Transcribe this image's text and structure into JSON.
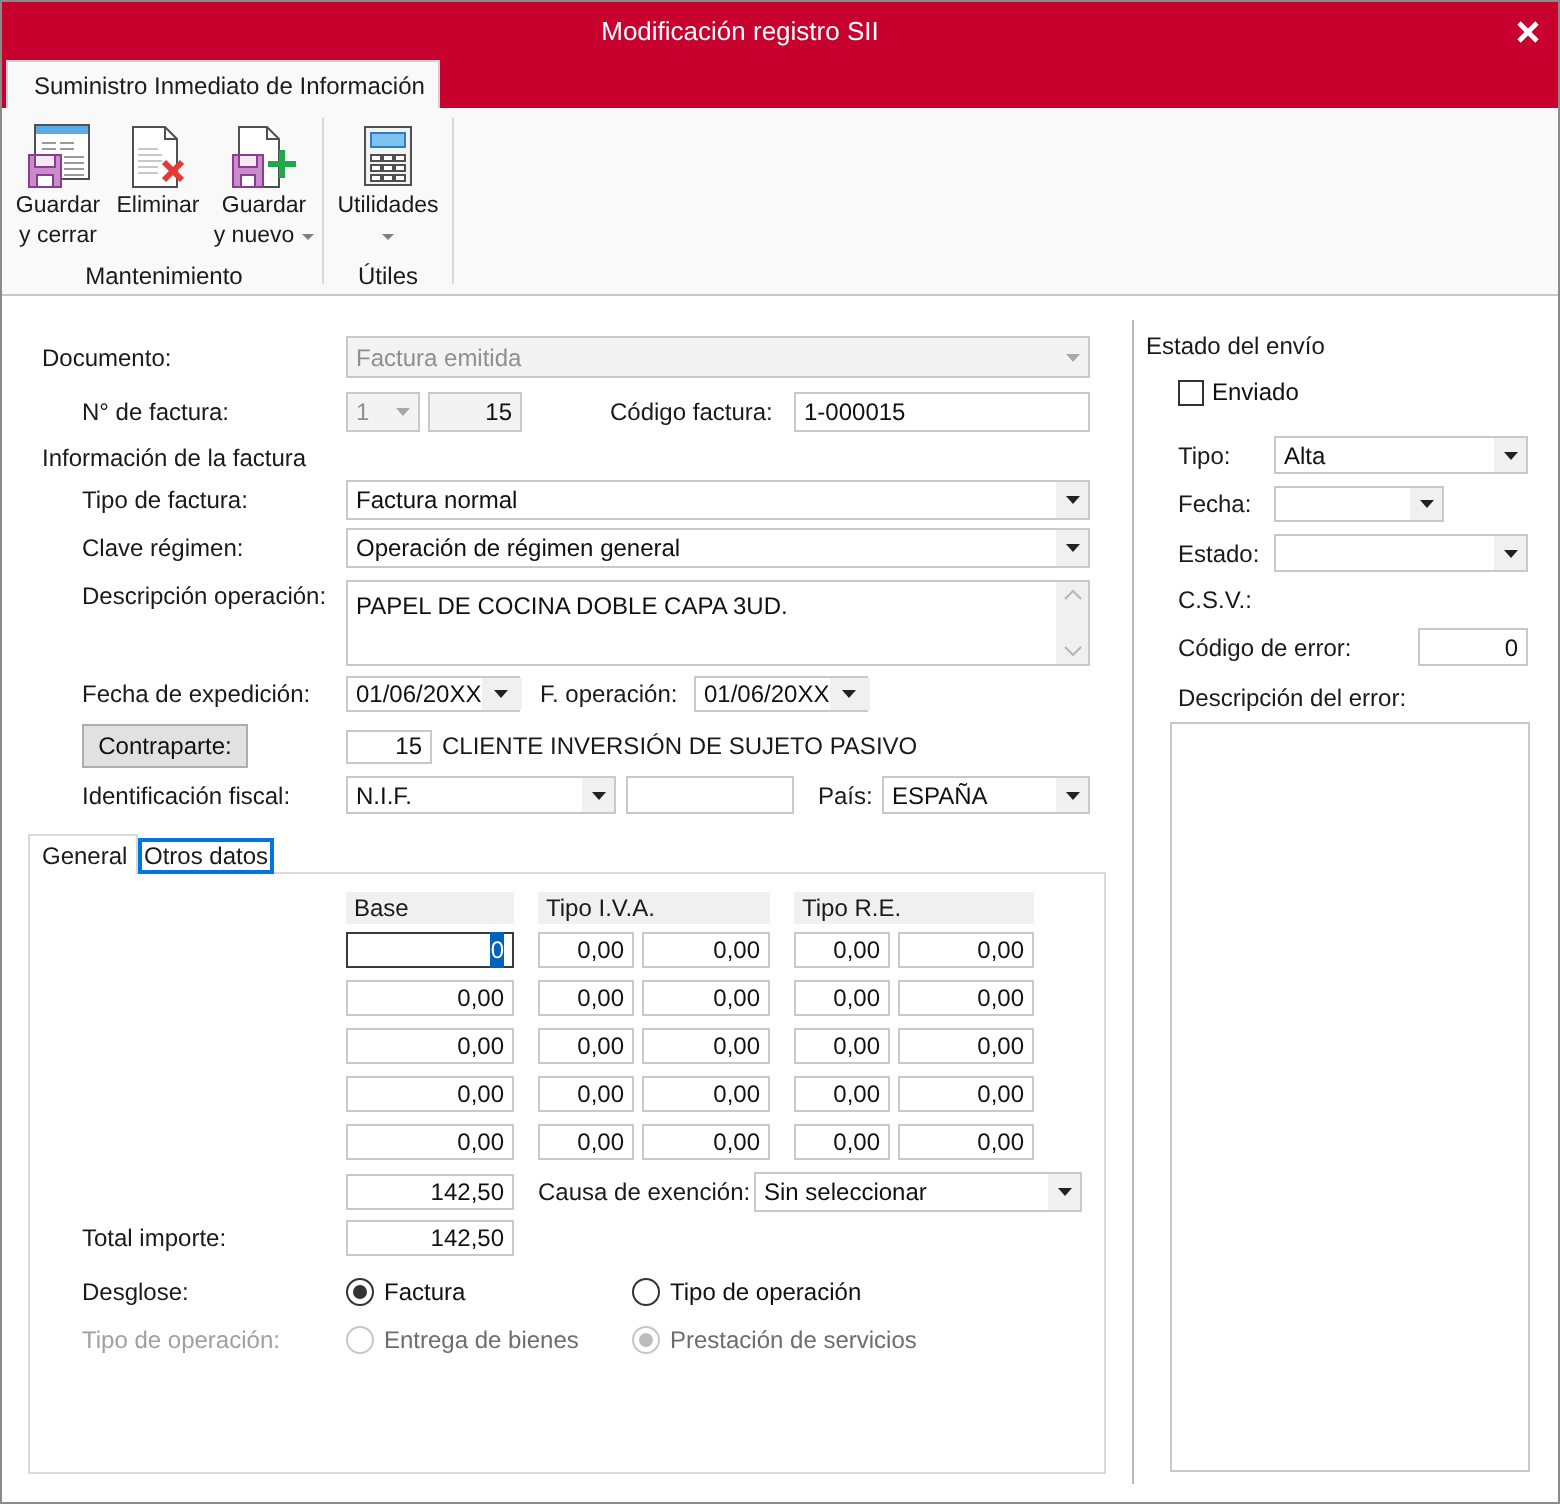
{
  "window": {
    "title": "Modificación registro SII"
  },
  "ribbon": {
    "tabs": [
      {
        "label": "Suministro Inmediato de Información",
        "selected": true
      }
    ],
    "groups": [
      {
        "label": "Mantenimiento",
        "buttons": [
          {
            "kind": "save_close",
            "lines": [
              "Guardar",
              "y cerrar"
            ],
            "dropdown": false
          },
          {
            "kind": "delete",
            "lines": [
              "Eliminar"
            ],
            "dropdown": false
          },
          {
            "kind": "save_new",
            "lines": [
              "Guardar",
              "y nuevo"
            ],
            "dropdown": true
          }
        ]
      },
      {
        "label": "Útiles",
        "buttons": [
          {
            "kind": "calculator",
            "lines": [
              "Utilidades"
            ],
            "dropdown": true
          }
        ]
      }
    ]
  },
  "document": {
    "label": "Documento:",
    "value": "Factura emitida",
    "disabled": true
  },
  "invoice_number": {
    "label": "N° de factura:",
    "series": {
      "value": "1",
      "disabled": true
    },
    "number": {
      "value": "15",
      "read_only": true
    }
  },
  "invoice_code": {
    "label": "Código factura:",
    "value": "1-000015"
  },
  "invoice_info": {
    "heading": "Información de la factura",
    "invoice_type": {
      "label": "Tipo de factura:",
      "value": "Factura normal"
    },
    "regime_key": {
      "label": "Clave régimen:",
      "value": "Operación de régimen general"
    },
    "description": {
      "label": "Descripción operación:",
      "value": "PAPEL DE COCINA DOBLE CAPA 3UD."
    },
    "issue_date": {
      "label": "Fecha de expedición:",
      "value": "01/06/20XX"
    },
    "operation_date": {
      "label": "F. operación:",
      "value": "01/06/20XX"
    },
    "counterpart": {
      "button": "Contraparte:",
      "code": "15",
      "name": "CLIENTE INVERSIÓN DE SUJETO PASIVO"
    },
    "tax_id": {
      "label": "Identificación fiscal:",
      "type": "N.I.F."
    },
    "country": {
      "label": "País:",
      "value": "ESPAÑA"
    }
  },
  "detail_tabs": [
    {
      "label": "General",
      "selected": true,
      "focused": false
    },
    {
      "label": "Otros datos",
      "selected": false,
      "focused": true
    }
  ],
  "tax_table": {
    "columns": [
      "Base",
      "Tipo I.V.A.",
      "",
      "Tipo R.E.",
      ""
    ],
    "rows": [
      {
        "cells": [
          {
            "value": "0",
            "focused": true
          },
          {
            "value": "0,00",
            "focused": false
          },
          {
            "value": "0,00",
            "focused": false
          },
          {
            "value": "0,00",
            "focused": false
          },
          {
            "value": "0,00",
            "focused": false
          }
        ]
      },
      {
        "cells": [
          {
            "value": "0,00",
            "focused": false
          },
          {
            "value": "0,00",
            "focused": false
          },
          {
            "value": "0,00",
            "focused": false
          },
          {
            "value": "0,00",
            "focused": false
          },
          {
            "value": "0,00",
            "focused": false
          }
        ]
      },
      {
        "cells": [
          {
            "value": "0,00",
            "focused": false
          },
          {
            "value": "0,00",
            "focused": false
          },
          {
            "value": "0,00",
            "focused": false
          },
          {
            "value": "0,00",
            "focused": false
          },
          {
            "value": "0,00",
            "focused": false
          }
        ]
      },
      {
        "cells": [
          {
            "value": "0,00",
            "focused": false
          },
          {
            "value": "0,00",
            "focused": false
          },
          {
            "value": "0,00",
            "focused": false
          },
          {
            "value": "0,00",
            "focused": false
          },
          {
            "value": "0,00",
            "focused": false
          }
        ]
      },
      {
        "cells": [
          {
            "value": "0,00",
            "focused": false
          },
          {
            "value": "0,00",
            "focused": false
          },
          {
            "value": "0,00",
            "focused": false
          },
          {
            "value": "0,00",
            "focused": false
          },
          {
            "value": "0,00",
            "focused": false
          }
        ]
      }
    ]
  },
  "subtotal": {
    "base": "142,50",
    "exemption": {
      "label": "Causa de exención:",
      "value": "Sin seleccionar"
    }
  },
  "total": {
    "label": "Total importe:",
    "value": "142,50"
  },
  "breakdown": {
    "label": "Desglose:",
    "disabled": false,
    "options": [
      {
        "label": "Factura",
        "selected": true
      },
      {
        "label": "Tipo de operación",
        "selected": false
      }
    ]
  },
  "operation_type": {
    "label": "Tipo de operación:",
    "disabled": true,
    "options": [
      {
        "label": "Entrega de bienes",
        "selected": false
      },
      {
        "label": "Prestación de servicios",
        "selected": true
      }
    ]
  },
  "submission_status": {
    "heading": "Estado del envío",
    "sent": {
      "label": "Enviado",
      "checked": false
    },
    "type": {
      "label": "Tipo:",
      "value": "Alta"
    },
    "date": {
      "label": "Fecha:"
    },
    "status": {
      "label": "Estado:"
    },
    "csv": {
      "label": "C.S.V.:"
    },
    "error_code": {
      "label": "Código de error:",
      "value": "0"
    },
    "error_description": {
      "label": "Descripción del error:"
    }
  }
}
